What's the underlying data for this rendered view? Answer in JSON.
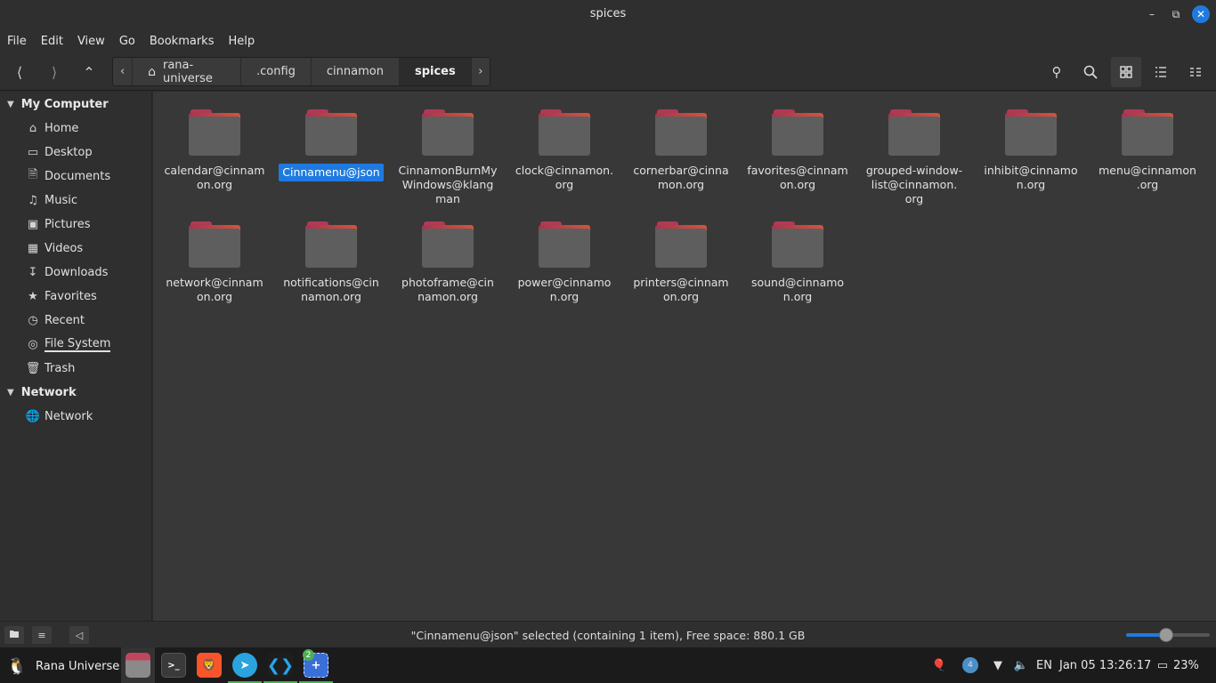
{
  "window": {
    "title": "spices",
    "min_icon": "minimize-icon",
    "max_icon": "maximize-icon",
    "close_icon": "close-icon"
  },
  "menubar": [
    "File",
    "Edit",
    "View",
    "Go",
    "Bookmarks",
    "Help"
  ],
  "toolbar": {
    "breadcrumbs": [
      "rana-universe",
      ".config",
      "cinnamon",
      "spices"
    ],
    "active_crumb": "spices"
  },
  "sidebar": {
    "sections": [
      {
        "title": "My Computer",
        "items": [
          {
            "label": "Home",
            "icon": "home-icon"
          },
          {
            "label": "Desktop",
            "icon": "desktop-icon"
          },
          {
            "label": "Documents",
            "icon": "documents-icon"
          },
          {
            "label": "Music",
            "icon": "music-icon"
          },
          {
            "label": "Pictures",
            "icon": "pictures-icon"
          },
          {
            "label": "Videos",
            "icon": "videos-icon"
          },
          {
            "label": "Downloads",
            "icon": "downloads-icon"
          },
          {
            "label": "Favorites",
            "icon": "star-icon"
          },
          {
            "label": "Recent",
            "icon": "recent-icon"
          },
          {
            "label": "File System",
            "icon": "filesystem-icon"
          },
          {
            "label": "Trash",
            "icon": "trash-icon"
          }
        ]
      },
      {
        "title": "Network",
        "items": [
          {
            "label": "Network",
            "icon": "globe-icon"
          }
        ]
      }
    ]
  },
  "files": [
    {
      "name": "calendar@cinnamon.org",
      "lines": [
        "calendar@cinnam",
        "on.org"
      ]
    },
    {
      "name": "Cinnamenu@json",
      "lines": [
        "Cinnamenu@json"
      ],
      "selected": true
    },
    {
      "name": "CinnamonBurnMyWindows@klangman",
      "lines": [
        "CinnamonBurnMy",
        "Windows@klang",
        "man"
      ]
    },
    {
      "name": "clock@cinnamon.org",
      "lines": [
        "clock@cinnamon.",
        "org"
      ]
    },
    {
      "name": "cornerbar@cinnamon.org",
      "lines": [
        "cornerbar@cinna",
        "mon.org"
      ]
    },
    {
      "name": "favorites@cinnamon.org",
      "lines": [
        "favorites@cinnam",
        "on.org"
      ]
    },
    {
      "name": "grouped-window-list@cinnamon.org",
      "lines": [
        "grouped-window-",
        "list@cinnamon.",
        "org"
      ]
    },
    {
      "name": "inhibit@cinnamon.org",
      "lines": [
        "inhibit@cinnamo",
        "n.org"
      ]
    },
    {
      "name": "menu@cinnamon.org",
      "lines": [
        "menu@cinnamon",
        ".org"
      ]
    },
    {
      "name": "network@cinnamon.org",
      "lines": [
        "network@cinnam",
        "on.org"
      ]
    },
    {
      "name": "notifications@cinnamon.org",
      "lines": [
        "notifications@cin",
        "namon.org"
      ]
    },
    {
      "name": "photoframe@cinnamon.org",
      "lines": [
        "photoframe@cin",
        "namon.org"
      ]
    },
    {
      "name": "power@cinnamon.org",
      "lines": [
        "power@cinnamo",
        "n.org"
      ]
    },
    {
      "name": "printers@cinnamon.org",
      "lines": [
        "printers@cinnam",
        "on.org"
      ]
    },
    {
      "name": "sound@cinnamon.org",
      "lines": [
        "sound@cinnamo",
        "n.org"
      ]
    }
  ],
  "statusbar": {
    "text": "\"Cinnamenu@json\" selected (containing 1 item), Free space: 880.1 GB",
    "zoom_level": 0.48
  },
  "taskbar": {
    "start_label": "Rana Universe",
    "apps": [
      {
        "name": "files",
        "icon": "folder-icon"
      },
      {
        "name": "terminal",
        "icon": "terminal-icon",
        "glyph": ">_"
      },
      {
        "name": "brave",
        "icon": "brave-icon"
      },
      {
        "name": "telegram",
        "icon": "telegram-icon"
      },
      {
        "name": "vscode",
        "icon": "vscode-icon"
      },
      {
        "name": "screenshot",
        "icon": "screenshot-icon",
        "badge": "2"
      }
    ],
    "tray": {
      "language": "EN",
      "datetime": "Jan 05 13:26:17",
      "battery": "23%",
      "update_badge": "4"
    }
  },
  "colors": {
    "accent": "#1f7ae0",
    "folder_tab": "#b03a56",
    "folder_body": "#5e5e5e"
  }
}
